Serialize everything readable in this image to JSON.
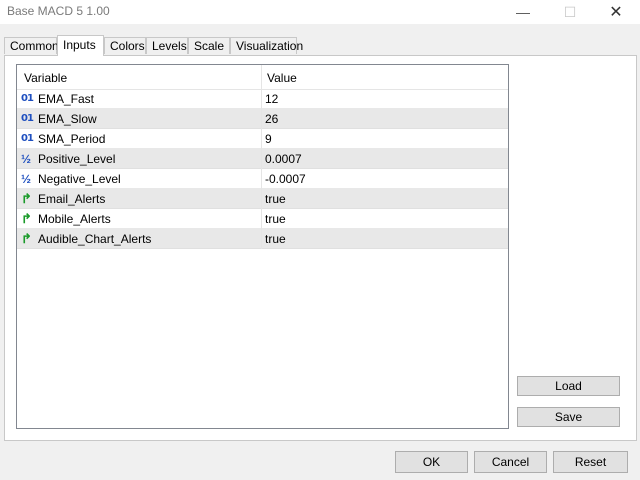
{
  "window": {
    "title": "Base MACD 5 1.00",
    "minimize_glyph": "—",
    "maximize_glyph": "☐",
    "close_glyph": "✕"
  },
  "tabs": [
    {
      "label": "Common"
    },
    {
      "label": "Inputs",
      "active": true
    },
    {
      "label": "Colors"
    },
    {
      "label": "Levels"
    },
    {
      "label": "Scale"
    },
    {
      "label": "Visualization"
    }
  ],
  "grid": {
    "headers": {
      "variable": "Variable",
      "value": "Value"
    },
    "rows": [
      {
        "icon": "integer-icon",
        "icon_glyph": "01",
        "variable": "EMA_Fast",
        "value": "12"
      },
      {
        "icon": "integer-icon",
        "icon_glyph": "01",
        "variable": "EMA_Slow",
        "value": "26"
      },
      {
        "icon": "integer-icon",
        "icon_glyph": "01",
        "variable": "SMA_Period",
        "value": "9"
      },
      {
        "icon": "double-icon",
        "icon_glyph": "½",
        "variable": "Positive_Level",
        "value": "0.0007"
      },
      {
        "icon": "double-icon",
        "icon_glyph": "½",
        "variable": "Negative_Level",
        "value": "-0.0007"
      },
      {
        "icon": "bool-icon",
        "icon_glyph": "↱",
        "variable": "Email_Alerts",
        "value": "true"
      },
      {
        "icon": "bool-icon",
        "icon_glyph": "↱",
        "variable": "Mobile_Alerts",
        "value": "true"
      },
      {
        "icon": "bool-icon",
        "icon_glyph": "↱",
        "variable": "Audible_Chart_Alerts",
        "value": "true"
      }
    ]
  },
  "buttons": {
    "load": "Load",
    "save": "Save",
    "ok": "OK",
    "cancel": "Cancel",
    "reset": "Reset"
  }
}
